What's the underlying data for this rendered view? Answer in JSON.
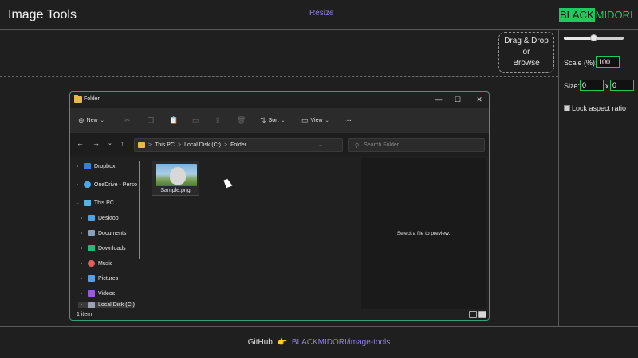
{
  "app": {
    "title": "Image Tools",
    "nav_resize": "Resize"
  },
  "brand": {
    "part1": "BLACK",
    "part2": "MIDORI",
    "accent": "#1ec95e"
  },
  "dropzone": {
    "line1": "Drag & Drop",
    "line2": "or",
    "line3": "Browse"
  },
  "panel": {
    "scale_slider_level": 0.5,
    "scale_label": "Scale (%):",
    "scale_value": "100",
    "size_label": "Size:",
    "width_value": "0",
    "times": "x",
    "height_value": "0",
    "lock_label": "Lock aspect ratio",
    "lock_checked": false
  },
  "footer": {
    "prefix": "GitHub",
    "emoji": "👉",
    "link_text": "BLACKMIDORI/image-tools"
  },
  "explorer": {
    "title": "Folder",
    "window_buttons": {
      "minimize": "—",
      "maximize": "☐",
      "close": "✕"
    },
    "toolbar": {
      "new_label": "New",
      "sort_label": "Sort",
      "view_label": "View",
      "more_label": "···"
    },
    "address": {
      "crumbs": [
        "This PC",
        "Local Disk (C:)",
        "Folder"
      ],
      "separator": ">"
    },
    "search_placeholder": "Search Folder",
    "nav": {
      "dropbox": "Dropbox",
      "onedrive": "OneDrive - Perso",
      "thispc": "This PC",
      "desktop": "Desktop",
      "documents": "Documents",
      "downloads": "Downloads",
      "music": "Music",
      "pictures": "Pictures",
      "videos": "Videos",
      "localdisk": "Local Disk (C:)"
    },
    "file": {
      "name": "Sample.png"
    },
    "preview_text": "Select a file to preview.",
    "status": {
      "count": "1 item"
    }
  }
}
